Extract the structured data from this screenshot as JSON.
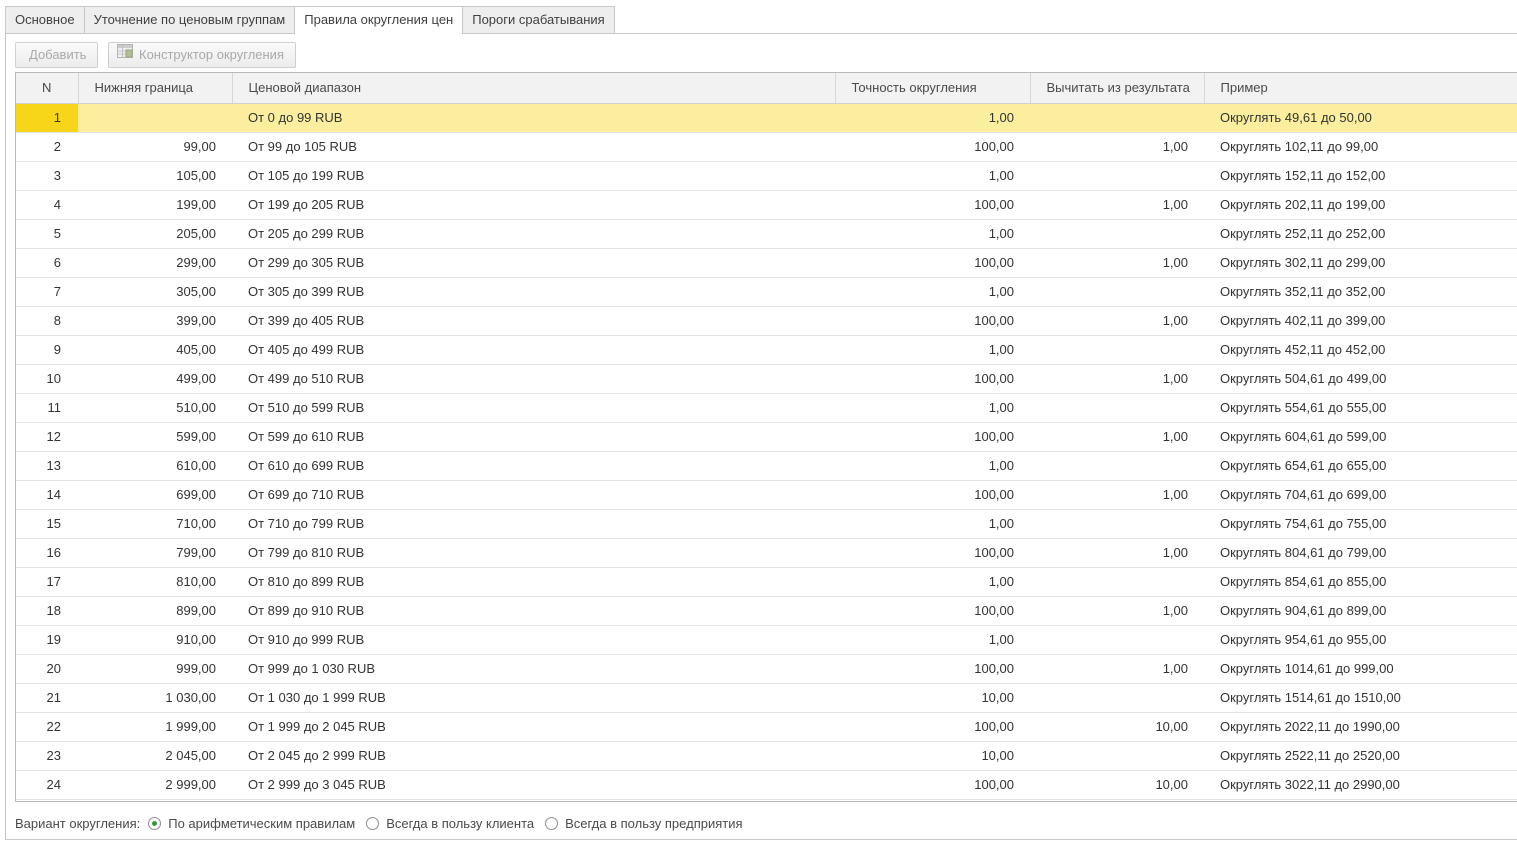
{
  "tabs": [
    {
      "label": "Основное",
      "active": false
    },
    {
      "label": "Уточнение по ценовым группам",
      "active": false
    },
    {
      "label": "Правила округления цен",
      "active": true
    },
    {
      "label": "Пороги срабатывания",
      "active": false
    }
  ],
  "toolbar": {
    "add_label": "Добавить",
    "constructor_label": "Конструктор округления",
    "constructor_icon": "table-constructor-icon"
  },
  "table": {
    "columns": [
      "N",
      "Нижняя граница",
      "Ценовой диапазон",
      "Точность округления",
      "Вычитать из результата",
      "Пример"
    ],
    "selected_row": 0,
    "rows": [
      {
        "n": "1",
        "lower": "",
        "range": "От 0 до 99 RUB",
        "precision": "1,00",
        "subtract": "",
        "example": "Округлять 49,61 до 50,00"
      },
      {
        "n": "2",
        "lower": "99,00",
        "range": "От 99 до 105 RUB",
        "precision": "100,00",
        "subtract": "1,00",
        "example": "Округлять 102,11 до 99,00"
      },
      {
        "n": "3",
        "lower": "105,00",
        "range": "От 105 до 199 RUB",
        "precision": "1,00",
        "subtract": "",
        "example": "Округлять 152,11 до 152,00"
      },
      {
        "n": "4",
        "lower": "199,00",
        "range": "От 199 до 205 RUB",
        "precision": "100,00",
        "subtract": "1,00",
        "example": "Округлять 202,11 до 199,00"
      },
      {
        "n": "5",
        "lower": "205,00",
        "range": "От 205 до 299 RUB",
        "precision": "1,00",
        "subtract": "",
        "example": "Округлять 252,11 до 252,00"
      },
      {
        "n": "6",
        "lower": "299,00",
        "range": "От 299 до 305 RUB",
        "precision": "100,00",
        "subtract": "1,00",
        "example": "Округлять 302,11 до 299,00"
      },
      {
        "n": "7",
        "lower": "305,00",
        "range": "От 305 до 399 RUB",
        "precision": "1,00",
        "subtract": "",
        "example": "Округлять 352,11 до 352,00"
      },
      {
        "n": "8",
        "lower": "399,00",
        "range": "От 399 до 405 RUB",
        "precision": "100,00",
        "subtract": "1,00",
        "example": "Округлять 402,11 до 399,00"
      },
      {
        "n": "9",
        "lower": "405,00",
        "range": "От 405 до 499 RUB",
        "precision": "1,00",
        "subtract": "",
        "example": "Округлять 452,11 до 452,00"
      },
      {
        "n": "10",
        "lower": "499,00",
        "range": "От 499 до 510 RUB",
        "precision": "100,00",
        "subtract": "1,00",
        "example": "Округлять 504,61 до 499,00"
      },
      {
        "n": "11",
        "lower": "510,00",
        "range": "От 510 до 599 RUB",
        "precision": "1,00",
        "subtract": "",
        "example": "Округлять 554,61 до 555,00"
      },
      {
        "n": "12",
        "lower": "599,00",
        "range": "От 599 до 610 RUB",
        "precision": "100,00",
        "subtract": "1,00",
        "example": "Округлять 604,61 до 599,00"
      },
      {
        "n": "13",
        "lower": "610,00",
        "range": "От 610 до 699 RUB",
        "precision": "1,00",
        "subtract": "",
        "example": "Округлять 654,61 до 655,00"
      },
      {
        "n": "14",
        "lower": "699,00",
        "range": "От 699 до 710 RUB",
        "precision": "100,00",
        "subtract": "1,00",
        "example": "Округлять 704,61 до 699,00"
      },
      {
        "n": "15",
        "lower": "710,00",
        "range": "От 710 до 799 RUB",
        "precision": "1,00",
        "subtract": "",
        "example": "Округлять 754,61 до 755,00"
      },
      {
        "n": "16",
        "lower": "799,00",
        "range": "От 799 до 810 RUB",
        "precision": "100,00",
        "subtract": "1,00",
        "example": "Округлять 804,61 до 799,00"
      },
      {
        "n": "17",
        "lower": "810,00",
        "range": "От 810 до 899 RUB",
        "precision": "1,00",
        "subtract": "",
        "example": "Округлять 854,61 до 855,00"
      },
      {
        "n": "18",
        "lower": "899,00",
        "range": "От 899 до 910 RUB",
        "precision": "100,00",
        "subtract": "1,00",
        "example": "Округлять 904,61 до 899,00"
      },
      {
        "n": "19",
        "lower": "910,00",
        "range": "От 910 до 999 RUB",
        "precision": "1,00",
        "subtract": "",
        "example": "Округлять 954,61 до 955,00"
      },
      {
        "n": "20",
        "lower": "999,00",
        "range": "От 999 до 1 030 RUB",
        "precision": "100,00",
        "subtract": "1,00",
        "example": "Округлять 1014,61 до 999,00"
      },
      {
        "n": "21",
        "lower": "1 030,00",
        "range": "От 1 030 до 1 999 RUB",
        "precision": "10,00",
        "subtract": "",
        "example": "Округлять 1514,61 до 1510,00"
      },
      {
        "n": "22",
        "lower": "1 999,00",
        "range": "От 1 999 до 2 045 RUB",
        "precision": "100,00",
        "subtract": "10,00",
        "example": "Округлять 2022,11 до 1990,00"
      },
      {
        "n": "23",
        "lower": "2 045,00",
        "range": "От 2 045 до 2 999 RUB",
        "precision": "10,00",
        "subtract": "",
        "example": "Округлять 2522,11 до 2520,00"
      },
      {
        "n": "24",
        "lower": "2 999,00",
        "range": "От 2 999 до 3 045 RUB",
        "precision": "100,00",
        "subtract": "10,00",
        "example": "Округлять 3022,11 до 2990,00"
      }
    ]
  },
  "rounding_option": {
    "label": "Вариант округления:",
    "options": [
      {
        "label": "По арифметическим правилам",
        "checked": true
      },
      {
        "label": "Всегда в пользу клиента",
        "checked": false
      },
      {
        "label": "Всегда в пользу предприятия",
        "checked": false
      }
    ]
  },
  "colors": {
    "selected_row": "#fbef9f",
    "selected_cell": "#f7d619",
    "radio_on": "#2e9a3e"
  }
}
